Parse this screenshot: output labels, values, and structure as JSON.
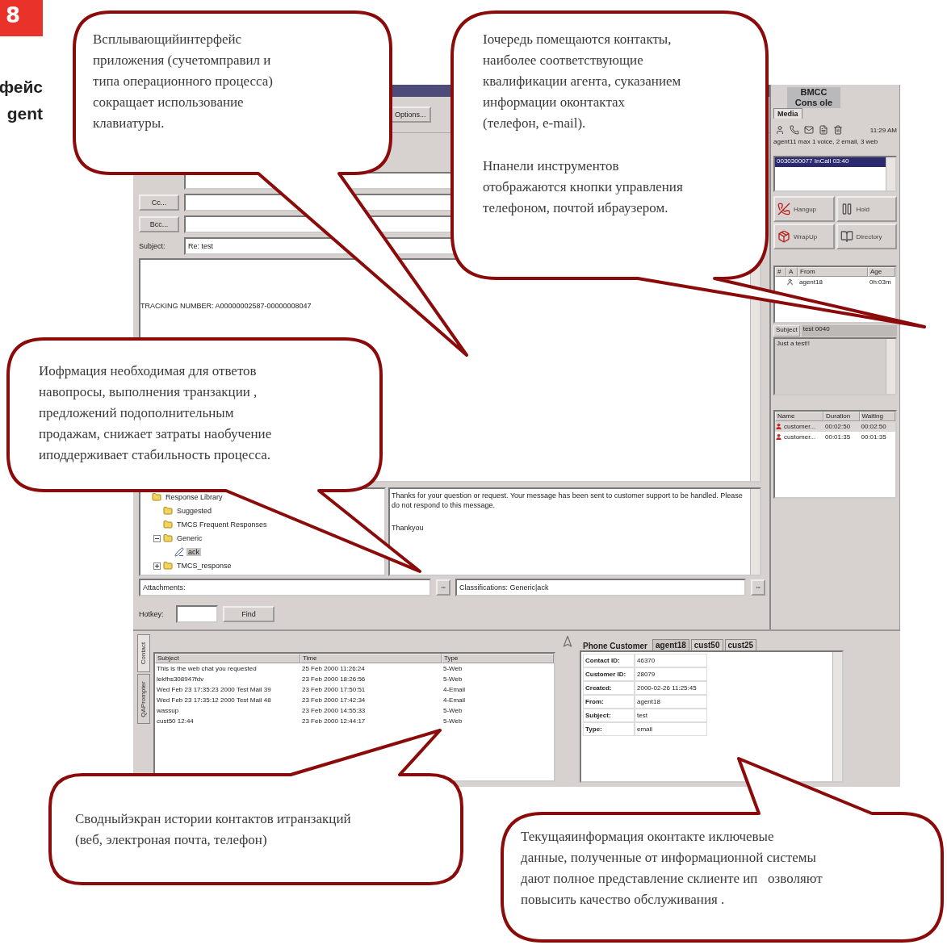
{
  "page_number": "8",
  "heading_lines": [
    "фейс",
    "gent"
  ],
  "main_window": {
    "options_button": "Options...",
    "address_buttons": [
      "Cc...",
      "Bcc..."
    ],
    "subject": {
      "label": "Subject:",
      "value": "Re: test"
    },
    "body": "TRACKING NUMBER: A00000002587-00000008047",
    "tree": [
      {
        "label": "Response Library",
        "selected": false,
        "children": [
          {
            "label": "Suggested",
            "selected": false
          },
          {
            "label": "TMCS Frequent Responses",
            "selected": false
          },
          {
            "label": "Generic",
            "selected": false,
            "expanded": true,
            "children": [
              {
                "label": "ack",
                "selected": true,
                "kind": "response"
              }
            ]
          },
          {
            "label": "TMCS_response",
            "selected": false,
            "expanded": false
          }
        ]
      }
    ],
    "response_text": "Thanks for your question or request. Your message has been sent to customer support to be handled. Please do not respond to this message.",
    "response_closing": "Thankyou",
    "attachments_label": "Attachments:",
    "classifications": "Classifications: Generic|ack",
    "hotkey_label": "Hotkey:",
    "find_button": "Find"
  },
  "console": {
    "title": "BMCC\nCons ole",
    "tab": "Media",
    "time": "11:29 AM",
    "status": "agent11 max 1 voice, 2 email, 3 web",
    "calls": [
      {
        "text": "0030300077 InCall 03:40",
        "selected": true
      }
    ],
    "actions": [
      "Hangup",
      "Hold",
      "WrapUp",
      "Directory"
    ],
    "queue": {
      "columns": [
        "#",
        "A",
        "From",
        "Age"
      ],
      "rows": [
        {
          "from": "agent18",
          "age": "0h:03m"
        }
      ]
    },
    "subject_label": "Subject",
    "subject_value": "test 0040",
    "message": "Just a test!!",
    "waiting": {
      "columns": [
        "Name",
        "Duration",
        "Waiting"
      ],
      "rows": [
        {
          "name": "customer...",
          "duration": "00:02:50",
          "waiting": "00:02:50",
          "selected": true
        },
        {
          "name": "customer...",
          "duration": "00:01:35",
          "waiting": "00:01:35",
          "selected": false
        }
      ]
    }
  },
  "bottom": {
    "side_tabs": [
      {
        "label": "Contact",
        "selected": true
      },
      {
        "label": "QAPrompter",
        "selected": false
      }
    ],
    "history": {
      "columns": [
        "Subject",
        "Time",
        "Type"
      ],
      "rows": [
        [
          "This is the web chat you requested",
          "25 Feb 2000 11:26:24",
          "5-Web"
        ],
        [
          "lekfhs308947fdv",
          "23 Feb 2000 18:26:56",
          "5-Web"
        ],
        [
          "Wed Feb 23 17:35:23 2000 Test Mail 39",
          "23 Feb 2000 17:50:51",
          "4-Email"
        ],
        [
          "Wed Feb 23 17:35:12 2000 Test Mail 48",
          "23 Feb 2000 17:42:34",
          "4-Email"
        ],
        [
          "wassup",
          "23 Feb 2000 14:55:33",
          "5-Web"
        ],
        [
          "cust50 12:44",
          "23 Feb 2000 12:44:17",
          "5-Web"
        ]
      ]
    },
    "customer_title": "Phone Customer",
    "customer_tabs": [
      {
        "label": "agent18",
        "selected": true
      },
      {
        "label": "cust50",
        "selected": false
      },
      {
        "label": "cust25",
        "selected": false
      }
    ],
    "fields": [
      {
        "label": "Contact ID:",
        "value": "46370"
      },
      {
        "label": "Customer ID:",
        "value": "28079"
      },
      {
        "label": "Created:",
        "value": "2000-02-26 11:25:45"
      },
      {
        "label": "From:",
        "value": "agent18"
      },
      {
        "label": "Subject:",
        "value": "test"
      },
      {
        "label": "Type:",
        "value": "email"
      }
    ]
  },
  "callouts": [
    {
      "paragraphs": [
        "Всплывающийинтерфейс\nприложения (сучетомправил и\nтипа операционного процесса)\nсокращает использование\nклавиатуры."
      ]
    },
    {
      "paragraphs": [
        "Іочередь помещаются контакты,\nнаиболее соответствующие\nквалификации агента, суказанием\nинформации оконтактах\n(телефон, e-mail).",
        "Нпанели инструментов\nотображаются кнопки управления\nтелефоном, почтой ибраузером."
      ]
    },
    {
      "paragraphs": [
        "Иофрмация необходимая для ответов\nнавопросы, выполнения транзакции ,\nпредложений подополнительным\nпродажам, снижает затраты наобучение\nиподдерживает стабильность процесса."
      ]
    },
    {
      "paragraphs": [
        "Сводныйэкран истории контактов итранзакций\n(веб, электроная почта, телефон)"
      ]
    },
    {
      "paragraphs": [
        "Текущаяинформация оконтакте иключевые\nданные, полученные от информационной системы\nдают полное представление склиенте ип   озволяют\nповысить качество обслуживания ."
      ]
    }
  ]
}
